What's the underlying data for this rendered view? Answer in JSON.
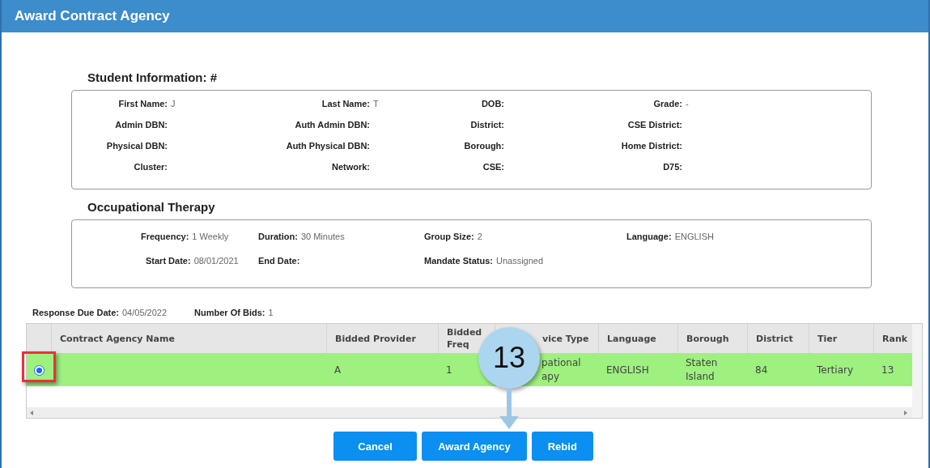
{
  "window": {
    "title": "Award Contract Agency"
  },
  "student_info": {
    "heading": "Student Information: #",
    "fields": [
      {
        "label": "First Name:",
        "value": "J"
      },
      {
        "label": "Last Name:",
        "value": "T"
      },
      {
        "label": "DOB:"
      },
      {
        "label": "Grade:",
        "value": "-"
      },
      {
        "label": "Admin DBN:"
      },
      {
        "label": "Auth Admin DBN:"
      },
      {
        "label": "District:"
      },
      {
        "label": "CSE District:"
      },
      {
        "label": "Physical DBN:"
      },
      {
        "label": "Auth Physical DBN:"
      },
      {
        "label": "Borough:"
      },
      {
        "label": "Home District:"
      },
      {
        "label": "Cluster:"
      },
      {
        "label": "Network:"
      },
      {
        "label": "CSE:"
      },
      {
        "label": "D75:"
      }
    ]
  },
  "mandate": {
    "heading": "Occupational Therapy",
    "fields": [
      {
        "label": "Frequency:",
        "value": "1 Weekly"
      },
      {
        "label": "Duration:",
        "value": "30 Minutes"
      },
      {
        "label": "Group Size:",
        "value": "2"
      },
      {
        "label": "Language:",
        "value": "ENGLISH"
      },
      {
        "label": "Start Date:",
        "value": "08/01/2021"
      },
      {
        "label": "End Date:"
      },
      {
        "label": "Mandate Status:",
        "value": "Unassigned"
      }
    ]
  },
  "summary": [
    {
      "label": "Response Due Date:",
      "value": "04/05/2022"
    },
    {
      "label": "Number Of Bids:",
      "value": "1"
    }
  ],
  "table": {
    "columns": [
      "Contract Agency Name",
      "Bidded Provider",
      "Bidded Freq",
      "vice Type",
      "Language",
      "Borough",
      "District",
      "Tier",
      "Rank"
    ],
    "rows": [
      {
        "selected": true,
        "highlighted": true,
        "cells": [
          "",
          "A",
          "1",
          "pational apy",
          "ENGLISH",
          "Staten Island",
          "84",
          "Tertiary",
          "13"
        ]
      }
    ]
  },
  "callout": {
    "number": "13"
  },
  "buttons": [
    "Cancel",
    "Award Agency",
    "Rebid"
  ]
}
